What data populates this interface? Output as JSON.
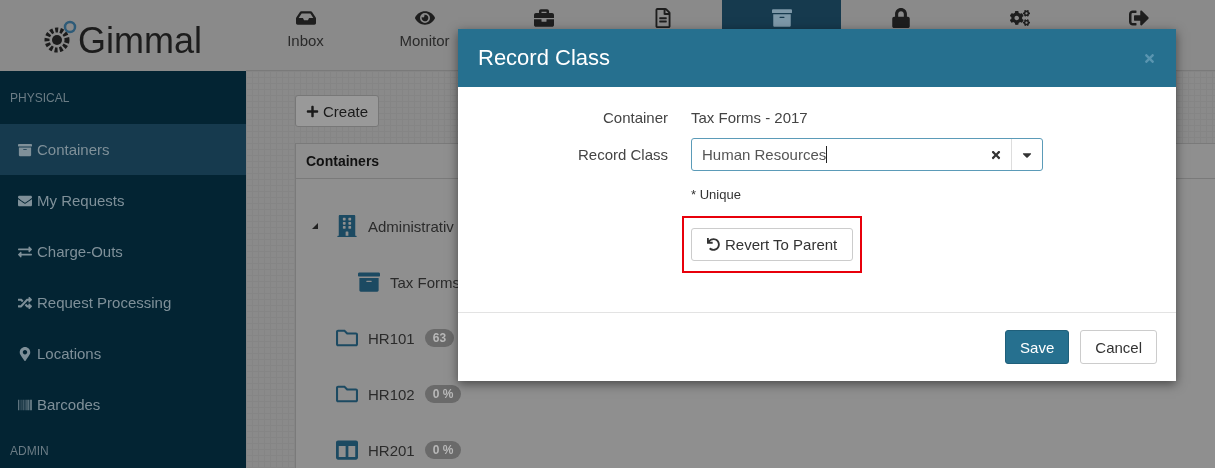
{
  "header": {
    "logo": "Gimmal",
    "nav": [
      {
        "label": "Inbox",
        "selected": false
      },
      {
        "label": "Monitor",
        "selected": false
      },
      {
        "selected": false
      },
      {
        "selected": false
      },
      {
        "selected": true
      },
      {
        "selected": false
      },
      {
        "selected": false
      },
      {
        "selected": false
      }
    ]
  },
  "sidebar": {
    "section": "PHYSICAL",
    "items": [
      {
        "label": "Containers",
        "selected": true
      },
      {
        "label": "My Requests",
        "selected": false
      },
      {
        "label": "Charge-Outs",
        "selected": false
      },
      {
        "label": "Request Processing",
        "selected": false
      },
      {
        "label": "Locations",
        "selected": false
      },
      {
        "label": "Barcodes",
        "selected": false
      }
    ],
    "next_section": "ADMIN"
  },
  "content": {
    "create_button": "Create",
    "panel_title": "Containers",
    "tree": [
      {
        "kind": "building",
        "label": "Administrativ",
        "expanded": true,
        "children": [
          {
            "kind": "box",
            "label": "Tax Forms"
          }
        ]
      },
      {
        "kind": "folder",
        "label": "HR101",
        "badge": "63"
      },
      {
        "kind": "folder",
        "label": "HR102",
        "badge": "0 %"
      },
      {
        "kind": "columns",
        "label": "HR201",
        "badge": "0 %"
      }
    ]
  },
  "dialog": {
    "title": "Record Class",
    "fields": [
      {
        "kind": "text",
        "label": "Container",
        "value": "Tax Forms - 2017"
      },
      {
        "kind": "select",
        "label": "Record Class",
        "value": "Human Resources",
        "hint": "* Unique"
      }
    ],
    "revert_button": {
      "label": "Revert To Parent",
      "highlighted": true
    },
    "buttons": [
      {
        "label": "Save",
        "primary": true
      },
      {
        "label": "Cancel",
        "primary": false
      }
    ]
  }
}
